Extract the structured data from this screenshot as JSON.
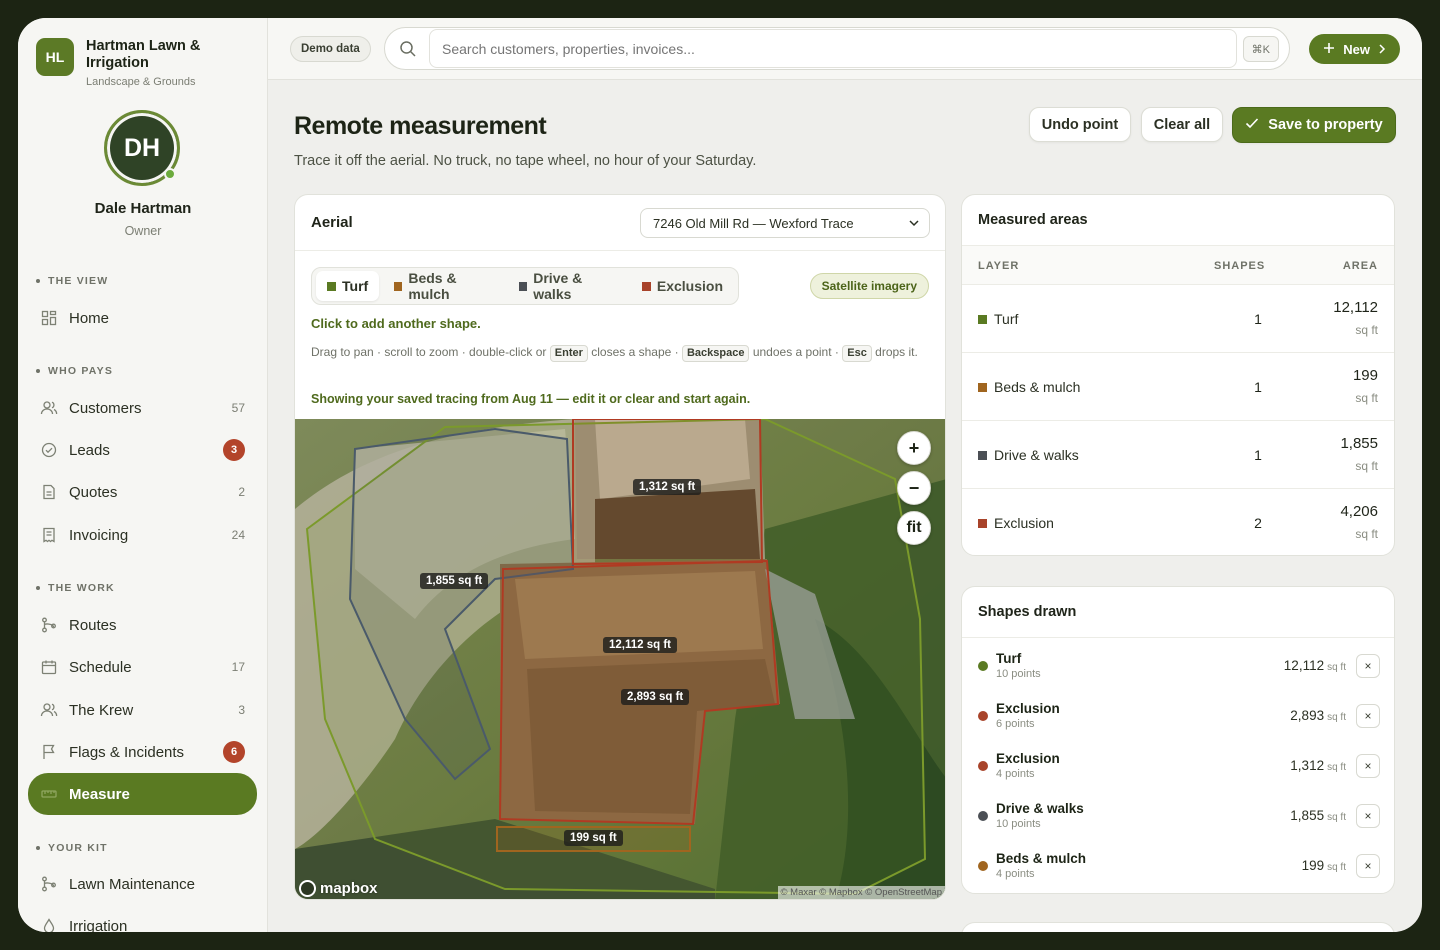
{
  "brand": {
    "initials": "HL",
    "name": "Hartman Lawn & Irrigation",
    "subtitle": "Landscape & Grounds"
  },
  "user": {
    "initials": "DH",
    "name": "Dale Hartman",
    "role": "Owner"
  },
  "sidebar": {
    "sections": [
      {
        "label": "THE VIEW"
      },
      {
        "label": "WHO PAYS"
      },
      {
        "label": "THE WORK"
      },
      {
        "label": "YOUR KIT"
      }
    ],
    "items": [
      {
        "label": "Home",
        "icon": "grid-icon"
      },
      {
        "label": "Customers",
        "icon": "users-icon",
        "count": "57"
      },
      {
        "label": "Leads",
        "icon": "check-circle-icon",
        "badge": "3"
      },
      {
        "label": "Quotes",
        "icon": "document-icon",
        "count": "2"
      },
      {
        "label": "Invoicing",
        "icon": "receipt-icon",
        "count": "24"
      },
      {
        "label": "Routes",
        "icon": "route-icon"
      },
      {
        "label": "Schedule",
        "icon": "calendar-icon",
        "count": "17"
      },
      {
        "label": "The Krew",
        "icon": "users-icon",
        "count": "3"
      },
      {
        "label": "Flags & Incidents",
        "icon": "flag-icon",
        "badge": "6"
      },
      {
        "label": "Measure",
        "icon": "ruler-icon",
        "active": true
      },
      {
        "label": "Lawn Maintenance",
        "icon": "route-icon"
      },
      {
        "label": "Irrigation",
        "icon": "drop-icon"
      }
    ]
  },
  "topbar": {
    "demo_label": "Demo data",
    "search_placeholder": "Search customers, properties, invoices...",
    "shortcut": "⌘K",
    "new_label": "New"
  },
  "page": {
    "title": "Remote measurement",
    "subtitle": "Trace it off the aerial. No truck, no tape wheel, no hour of your Saturday.",
    "undo_label": "Undo point",
    "clear_label": "Clear all",
    "save_label": "Save to property"
  },
  "aerial": {
    "title": "Aerial",
    "address": "7246 Old Mill Rd — Wexford Trace",
    "tabs": [
      {
        "label": "Turf",
        "color": "#5a7a22"
      },
      {
        "label": "Beds & mulch",
        "color": "#a0651f"
      },
      {
        "label": "Drive & walks",
        "color": "#4b4f55"
      },
      {
        "label": "Exclusion",
        "color": "#a8432a"
      }
    ],
    "imagery_label": "Satellite imagery",
    "hint_click": "Click to add another shape.",
    "hint_drag": "Drag to pan · scroll to zoom · double-click or",
    "hint_closes": "closes a shape ·",
    "hint_undoes": "undoes a point ·",
    "hint_drops": "drops it.",
    "key_enter": "Enter",
    "key_backspace": "Backspace",
    "key_esc": "Esc",
    "hint_saved": "Showing your saved tracing from Aug 11 — edit it or clear and start again.",
    "zoom_in": "+",
    "zoom_out": "−",
    "fit_label": "fit",
    "map_labels": [
      "1,312 sq ft",
      "1,855 sq ft",
      "12,112 sq ft",
      "2,893 sq ft",
      "199 sq ft"
    ],
    "mapbox_label": "mapbox",
    "attribution": "© Maxar © Mapbox © OpenStreetMap"
  },
  "measured": {
    "title": "Measured areas",
    "col_layer": "LAYER",
    "col_shapes": "SHAPES",
    "col_area": "AREA",
    "unit": "sq ft",
    "rows": [
      {
        "layer": "Turf",
        "color": "#5a7a22",
        "shapes": "1",
        "area": "12,112"
      },
      {
        "layer": "Beds & mulch",
        "color": "#a0651f",
        "shapes": "1",
        "area": "199"
      },
      {
        "layer": "Drive & walks",
        "color": "#4b4f55",
        "shapes": "1",
        "area": "1,855"
      },
      {
        "layer": "Exclusion",
        "color": "#a8432a",
        "shapes": "2",
        "area": "4,206"
      }
    ]
  },
  "shapes": {
    "title": "Shapes drawn",
    "unit": "sq ft",
    "remove": "×",
    "rows": [
      {
        "name": "Turf",
        "points": "10 points",
        "value": "12,112",
        "color": "#5a7a22"
      },
      {
        "name": "Exclusion",
        "points": "6 points",
        "value": "2,893",
        "color": "#a8432a"
      },
      {
        "name": "Exclusion",
        "points": "4 points",
        "value": "1,312",
        "color": "#a8432a"
      },
      {
        "name": "Drive & walks",
        "points": "10 points",
        "value": "1,855",
        "color": "#4b4f55"
      },
      {
        "name": "Beds & mulch",
        "points": "4 points",
        "value": "199",
        "color": "#a0651f"
      }
    ]
  }
}
